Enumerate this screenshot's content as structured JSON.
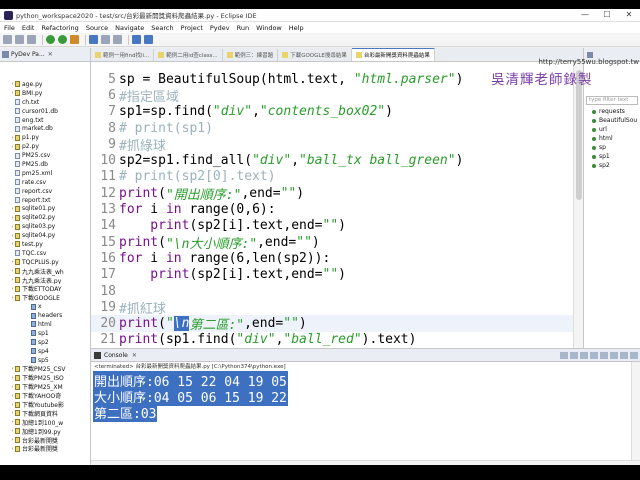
{
  "window": {
    "title": "python_workspace2020 - test/src/台彩最新開獎資料爬蟲結果.py - Eclipse IDE",
    "controls": [
      "—",
      "☐",
      "✕"
    ]
  },
  "menu": [
    "File",
    "Edit",
    "Refactoring",
    "Source",
    "Navigate",
    "Search",
    "Project",
    "Pydev",
    "Run",
    "Window",
    "Help"
  ],
  "explorer": {
    "title": "PyDev Pa...",
    "items": [
      {
        "label": "age.py",
        "kind": "py"
      },
      {
        "label": "BMI.py",
        "kind": "py"
      },
      {
        "label": "ch.txt",
        "kind": "file"
      },
      {
        "label": "cursor01.db",
        "kind": "file"
      },
      {
        "label": "eng.txt",
        "kind": "file"
      },
      {
        "label": "market.db",
        "kind": "file"
      },
      {
        "label": "p1.py",
        "kind": "py"
      },
      {
        "label": "p2.py",
        "kind": "py"
      },
      {
        "label": "PM25.csv",
        "kind": "file"
      },
      {
        "label": "PM25.db",
        "kind": "file"
      },
      {
        "label": "pm25.xml",
        "kind": "file"
      },
      {
        "label": "rate.csv",
        "kind": "file"
      },
      {
        "label": "report.csv",
        "kind": "file"
      },
      {
        "label": "report.txt",
        "kind": "file"
      },
      {
        "label": "sqlite01.py",
        "kind": "py"
      },
      {
        "label": "sqlite02.py",
        "kind": "py"
      },
      {
        "label": "sqlite03.py",
        "kind": "py"
      },
      {
        "label": "sqlite04.py",
        "kind": "py"
      },
      {
        "label": "test.py",
        "kind": "py"
      },
      {
        "label": "TQC.csv",
        "kind": "file"
      },
      {
        "label": "TQCPLUS.py",
        "kind": "py"
      },
      {
        "label": "九九乘法表_wh",
        "kind": "py"
      },
      {
        "label": "九九乘法表.py",
        "kind": "py"
      },
      {
        "label": "下載ETTODAY",
        "kind": "py"
      },
      {
        "label": "下載GOOGLE",
        "kind": "py"
      },
      {
        "label": "x",
        "kind": "sub"
      },
      {
        "label": "headers",
        "kind": "sub"
      },
      {
        "label": "html",
        "kind": "sub"
      },
      {
        "label": "sp1",
        "kind": "sub"
      },
      {
        "label": "sp2",
        "kind": "sub"
      },
      {
        "label": "sp4",
        "kind": "sub"
      },
      {
        "label": "sp5",
        "kind": "sub"
      },
      {
        "label": "下載PM25_CSV",
        "kind": "py"
      },
      {
        "label": "下載PM25_ISO",
        "kind": "py"
      },
      {
        "label": "下載PM25_XM",
        "kind": "py"
      },
      {
        "label": "下載YAHOO奇",
        "kind": "py"
      },
      {
        "label": "下載Youtube影",
        "kind": "py"
      },
      {
        "label": "下載網頁資料",
        "kind": "py"
      },
      {
        "label": "加總1到100_w",
        "kind": "py"
      },
      {
        "label": "加總1到99.py",
        "kind": "py"
      },
      {
        "label": "台彩最新開獎",
        "kind": "py"
      },
      {
        "label": "台彩最新開獎",
        "kind": "py"
      }
    ]
  },
  "editor": {
    "tabs": [
      {
        "label": "範例一用find找li...",
        "active": false
      },
      {
        "label": "範例二用id查class...",
        "active": false
      },
      {
        "label": "範例三：練習題",
        "active": false
      },
      {
        "label": "下載GOOGLE搜尋結果",
        "active": false
      },
      {
        "label": "台彩最新開獎資料爬蟲結果",
        "active": true
      }
    ],
    "lines": [
      {
        "num": "5",
        "segs": [
          {
            "t": "sp = BeautifulSoup(html.text, ",
            "c": "cc"
          },
          {
            "t": "\"html.parser\"",
            "c": "st"
          },
          {
            "t": ")",
            "c": "cc"
          }
        ]
      },
      {
        "num": "6",
        "segs": [
          {
            "t": "#指定區域",
            "c": "cm"
          }
        ]
      },
      {
        "num": "7",
        "segs": [
          {
            "t": "sp1=sp.find(",
            "c": "cc"
          },
          {
            "t": "\"div\"",
            "c": "st"
          },
          {
            "t": ",",
            "c": "cc"
          },
          {
            "t": "\"contents_box02\"",
            "c": "st"
          },
          {
            "t": ")",
            "c": "cc"
          }
        ]
      },
      {
        "num": "8",
        "segs": [
          {
            "t": "# print(sp1)",
            "c": "cm"
          }
        ]
      },
      {
        "num": "9",
        "segs": [
          {
            "t": "#抓綠球",
            "c": "cm"
          }
        ]
      },
      {
        "num": "10",
        "segs": [
          {
            "t": "sp2=sp1.find_all(",
            "c": "cc"
          },
          {
            "t": "\"div\"",
            "c": "st"
          },
          {
            "t": ",",
            "c": "cc"
          },
          {
            "t": "\"ball_tx ball_green\"",
            "c": "st"
          },
          {
            "t": ")",
            "c": "cc"
          }
        ]
      },
      {
        "num": "11",
        "segs": [
          {
            "t": "# print(sp2[0].text)",
            "c": "cm"
          }
        ]
      },
      {
        "num": "12",
        "segs": [
          {
            "t": "print",
            "c": "kw"
          },
          {
            "t": "(",
            "c": "cc"
          },
          {
            "t": "\"開出順序:\"",
            "c": "st"
          },
          {
            "t": ",end=",
            "c": "cc"
          },
          {
            "t": "\"\"",
            "c": "st"
          },
          {
            "t": ")",
            "c": "cc"
          }
        ]
      },
      {
        "num": "13",
        "segs": [
          {
            "t": "for",
            "c": "kw"
          },
          {
            "t": " i ",
            "c": "cc"
          },
          {
            "t": "in",
            "c": "kw"
          },
          {
            "t": " range(0,6):",
            "c": "cc"
          }
        ]
      },
      {
        "num": "14",
        "segs": [
          {
            "t": "    print",
            "c": "kw"
          },
          {
            "t": "(sp2[i].text,end=",
            "c": "cc"
          },
          {
            "t": "\"\"",
            "c": "st"
          },
          {
            "t": ")",
            "c": "cc"
          }
        ]
      },
      {
        "num": "15",
        "segs": [
          {
            "t": "print",
            "c": "kw"
          },
          {
            "t": "(",
            "c": "cc"
          },
          {
            "t": "\"\\n大小順序:\"",
            "c": "st"
          },
          {
            "t": ",end=",
            "c": "cc"
          },
          {
            "t": "\"\"",
            "c": "st"
          },
          {
            "t": ")",
            "c": "cc"
          }
        ]
      },
      {
        "num": "16",
        "segs": [
          {
            "t": "for",
            "c": "kw"
          },
          {
            "t": " i ",
            "c": "cc"
          },
          {
            "t": "in",
            "c": "kw"
          },
          {
            "t": " range(6,len(sp2)):",
            "c": "cc"
          }
        ]
      },
      {
        "num": "17",
        "segs": [
          {
            "t": "    print",
            "c": "kw"
          },
          {
            "t": "(sp2[i].text,end=",
            "c": "cc"
          },
          {
            "t": "\"\"",
            "c": "st"
          },
          {
            "t": ")",
            "c": "cc"
          }
        ]
      },
      {
        "num": "18",
        "segs": [
          {
            "t": "",
            "c": "cc"
          }
        ]
      },
      {
        "num": "19",
        "segs": [
          {
            "t": "#抓紅球",
            "c": "cm"
          }
        ]
      },
      {
        "num": "20",
        "segs": [
          {
            "t": "print",
            "c": "kw"
          },
          {
            "t": "(",
            "c": "cc"
          },
          {
            "t": "\"",
            "c": "st"
          },
          {
            "t": "\\n",
            "c": "hl"
          },
          {
            "t": "第二區:\"",
            "c": "st"
          },
          {
            "t": ",end=",
            "c": "cc"
          },
          {
            "t": "\"\"",
            "c": "st"
          },
          {
            "t": ")",
            "c": "cc"
          }
        ],
        "current": true
      },
      {
        "num": "21",
        "segs": [
          {
            "t": "print",
            "c": "kw"
          },
          {
            "t": "(sp1.find(",
            "c": "cc"
          },
          {
            "t": "\"div\"",
            "c": "st"
          },
          {
            "t": ",",
            "c": "cc"
          },
          {
            "t": "\"ball_red\"",
            "c": "st"
          },
          {
            "t": ").text)",
            "c": "cc"
          }
        ]
      }
    ]
  },
  "watermark": {
    "url": "http://terry55wu.blogspot.tw",
    "name": "吳清輝老師錄製"
  },
  "outline": {
    "filter_placeholder": "type filter text",
    "items": [
      "requests",
      "BeautifulSou",
      "url",
      "html",
      "sp",
      "sp1",
      "sp2"
    ]
  },
  "console": {
    "title": "Console",
    "close": "✕",
    "status": "<terminated> 台彩最新開獎資料爬蟲結果.py [C:\\Python374\\python.exe]",
    "output": [
      "開出順序:06 15 22 04 19 05",
      "大小順序:04 05 06 15 19 22",
      "第二區:03"
    ]
  },
  "colors": {
    "keyword": "#7b0e8e",
    "string": "#2a9d2a",
    "comment": "#9ab2bd",
    "selection": "#3d70c0"
  }
}
